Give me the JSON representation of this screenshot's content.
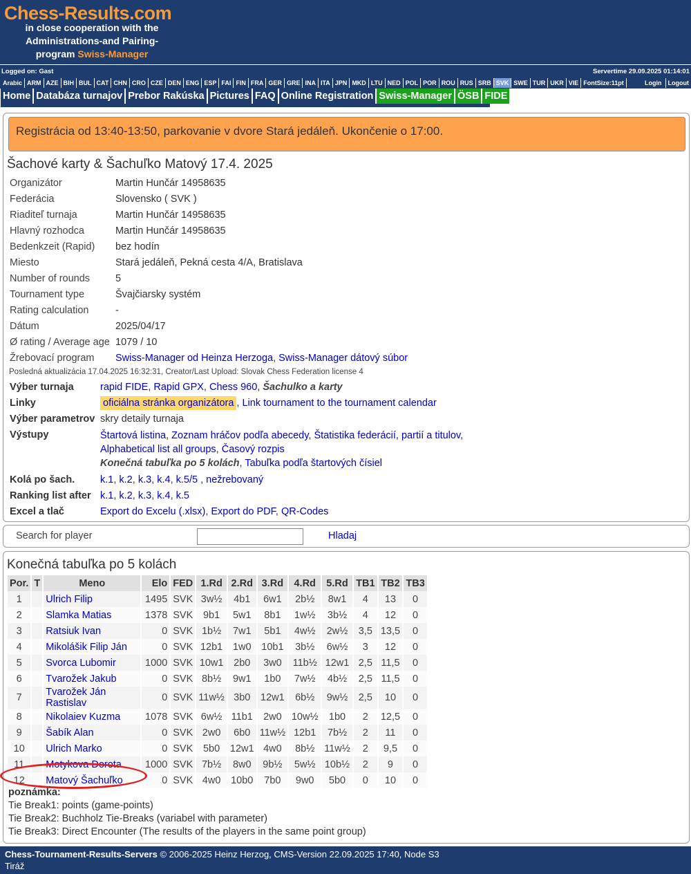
{
  "header": {
    "logo": "Chess-Results.com",
    "tagline_1": "in close cooperation with the Administrations-and Pairing-program",
    "tagline_2": "Swiss-Manager"
  },
  "topbar": {
    "logged_on": "Logged on: Gast",
    "servertime": "Servertime 29.09.2025 01:14:01"
  },
  "languages": [
    "Arabic",
    "ARM",
    "AZE",
    "BIH",
    "BUL",
    "CAT",
    "CHN",
    "CRO",
    "CZE",
    "DEN",
    "ENG",
    "ESP",
    "FAI",
    "FIN",
    "FRA",
    "GER",
    "GRE",
    "INA",
    "ITA",
    "JPN",
    "MKD",
    "LTU",
    "NED",
    "POL",
    "POR",
    "ROU",
    "RUS",
    "SRB",
    "SVK",
    "SWE",
    "TUR",
    "UKR",
    "VIE",
    "FontSize:11pt"
  ],
  "active_language": "SVK",
  "login": "Login",
  "logout": "Logout",
  "nav": [
    {
      "label": "Home",
      "green": false
    },
    {
      "label": "Databáza turnajov",
      "green": false
    },
    {
      "label": "Prebor Rakúska",
      "green": false
    },
    {
      "label": "Pictures",
      "green": false
    },
    {
      "label": "FAQ",
      "green": false
    },
    {
      "label": "Online Registration",
      "green": false
    },
    {
      "label": "Swiss-Manager",
      "green": true
    },
    {
      "label": "ÖSB",
      "green": true
    },
    {
      "label": "FIDE",
      "green": true
    }
  ],
  "notice": "Registrácia od 13:40-13:50, parkovanie v dvore Stará jedáleň. Ukončenie o 17:00.",
  "tournament_title": "Šachové karty & Šachuľko Matový 17.4. 2025",
  "info": [
    {
      "k": "Organizátor",
      "v": "Martin Hunčár 14958635"
    },
    {
      "k": "Federácia",
      "v": "Slovensko ( SVK )"
    },
    {
      "k": "Riaditeľ turnaja",
      "v": "Martin Hunčár 14958635"
    },
    {
      "k": "Hlavný rozhodca",
      "v": "Martin Hunčár 14958635"
    },
    {
      "k": "Bedenkzeit (Rapid)",
      "v": "bez hodín"
    },
    {
      "k": "Miesto",
      "v": "Stará jedáleň, Pekná cesta 4/A, Bratislava",
      "link": true
    },
    {
      "k": "Number of rounds",
      "v": "5"
    },
    {
      "k": "Tournament type",
      "v": "Švajčiarsky systém"
    },
    {
      "k": "Rating calculation",
      "v": "-"
    },
    {
      "k": "Dátum",
      "v": "2025/04/17"
    },
    {
      "k": "Ø rating / Average age",
      "v": "1079 / 10"
    }
  ],
  "pairing_program": {
    "k": "Žrebovací program",
    "v1": "Swiss-Manager od Heinza Herzoga",
    "v2": "Swiss-Manager dátový súbor"
  },
  "last_update": "Posledná aktualizácia 17.04.2025 16:32:31, Creator/Last Upload: Slovak Chess Federation license 4",
  "links": {
    "vyber_turnaja": {
      "k": "Výber turnaja",
      "items": [
        "rapid FIDE",
        "Rapid GPX",
        "Chess 960"
      ],
      "current": "Šachulko a karty"
    },
    "linky": {
      "k": "Linky",
      "hl": "oficiálna stránka organizátora",
      "other": "Link tournament to the tournament calendar"
    },
    "parametre": {
      "k": "Výber parametrov",
      "v": "skry detaily turnaja"
    },
    "vystupy": {
      "k": "Výstupy",
      "line1": [
        "Štartová listina",
        "Zoznam hráčov podľa abecedy",
        "Štatistika federácií, partií a titulov"
      ],
      "line2": [
        "Alphabetical list all groups",
        "Časový rozpis"
      ],
      "line3_current": "Konečná tabuľka po 5 kolách",
      "line3_link": "Tabuľka podľa štartových čísiel"
    },
    "kola": {
      "k": "Kolá po šach.",
      "items": [
        "k.1",
        "k.2",
        "k.3",
        "k.4",
        "k.5/5"
      ],
      "extra": "nežrebovaný"
    },
    "ranking": {
      "k": "Ranking list after",
      "items": [
        "k.1",
        "k.2",
        "k.3",
        "k.4",
        "k.5"
      ]
    },
    "excel": {
      "k": "Excel a tlač",
      "items": [
        "Export do Excelu (.xlsx)",
        "Export do PDF",
        "QR-Codes"
      ]
    }
  },
  "search": {
    "label": "Search for player",
    "button": "Hladaj",
    "value": ""
  },
  "standings": {
    "title": "Konečná tabuľka po 5 kolách",
    "columns": [
      "Por.",
      "T",
      "Meno",
      "Elo",
      "FED",
      "1.Rd",
      "2.Rd",
      "3.Rd",
      "4.Rd",
      "5.Rd",
      "TB1",
      "TB2",
      "TB3"
    ],
    "rows": [
      [
        "1",
        "",
        "Ulrich Filip",
        "1495",
        "SVK",
        "3w½",
        "4b1",
        "6w1",
        "2b½",
        "8w1",
        "4",
        "13",
        "0"
      ],
      [
        "2",
        "",
        "Slamka Matias",
        "1378",
        "SVK",
        "9b1",
        "5w1",
        "8b1",
        "1w½",
        "3b½",
        "4",
        "12",
        "0"
      ],
      [
        "3",
        "",
        "Ratsiuk Ivan",
        "0",
        "SVK",
        "1b½",
        "7w1",
        "5b1",
        "4w½",
        "2w½",
        "3,5",
        "13,5",
        "0"
      ],
      [
        "4",
        "",
        "Mikolášik Filip Ján",
        "0",
        "SVK",
        "12b1",
        "1w0",
        "10b1",
        "3b½",
        "6w½",
        "3",
        "12",
        "0"
      ],
      [
        "5",
        "",
        "Svorca Lubomir",
        "1000",
        "SVK",
        "10w1",
        "2b0",
        "3w0",
        "11b½",
        "12w1",
        "2,5",
        "11,5",
        "0"
      ],
      [
        "6",
        "",
        "Tvarožek Jakub",
        "0",
        "SVK",
        "8b½",
        "9w1",
        "1b0",
        "7w½",
        "4b½",
        "2,5",
        "11,5",
        "0"
      ],
      [
        "7",
        "",
        "Tvarožek Ján Rastislav",
        "0",
        "SVK",
        "11w½",
        "3b0",
        "12w1",
        "6b½",
        "9w½",
        "2,5",
        "10",
        "0"
      ],
      [
        "8",
        "",
        "Nikolaiev Kuzma",
        "1078",
        "SVK",
        "6w½",
        "11b1",
        "2w0",
        "10w½",
        "1b0",
        "2",
        "12,5",
        "0"
      ],
      [
        "9",
        "",
        "Šabík Alan",
        "0",
        "SVK",
        "2w0",
        "6b0",
        "11w½",
        "12b1",
        "7b½",
        "2",
        "11",
        "0"
      ],
      [
        "10",
        "",
        "Ulrich Marko",
        "0",
        "SVK",
        "5b0",
        "12w1",
        "4w0",
        "8b½",
        "11w½",
        "2",
        "9,5",
        "0"
      ],
      [
        "11",
        "",
        "Motykova Dorota",
        "1000",
        "SVK",
        "7b½",
        "8w0",
        "9b½",
        "5w½",
        "10b½",
        "2",
        "9",
        "0"
      ],
      [
        "12",
        "",
        "Matový Šachuľko",
        "0",
        "SVK",
        "4w0",
        "10b0",
        "7b0",
        "9w0",
        "5b0",
        "0",
        "10",
        "0"
      ]
    ]
  },
  "notes": {
    "heading": "poznámka:",
    "lines": [
      "Tie Break1: points (game-points)",
      "Tie Break2: Buchholz Tie-Breaks (variabel with parameter)",
      "Tie Break3: Direct Encounter (The results of the players in the same point group)"
    ]
  },
  "footer": {
    "brand": "Chess-Tournament-Results-Servers",
    "copyright": "© 2006-2025 Heinz Herzog, CMS-Version 22.09.2025 17:40, Node S3",
    "imprint": "Tiráž"
  },
  "colors": {
    "header_bg": "#1f3c6e",
    "accent_orange": "#f59c3a",
    "notice_bg": "#ffa24d",
    "nav_green": "#1aa21a",
    "annotation_red": "#e02020"
  }
}
